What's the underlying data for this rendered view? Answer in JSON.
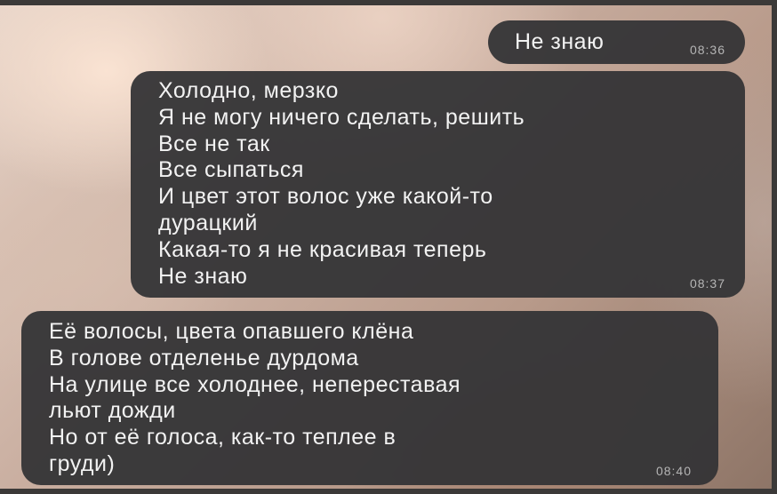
{
  "messages": [
    {
      "direction": "outgoing",
      "text": "Не знаю",
      "time": "08:36"
    },
    {
      "direction": "outgoing",
      "text": "Холодно, мерзко\nЯ не могу ничего сделать, решить\nВсе не так\nВсе сыпаться\nИ цвет этот волос уже какой-то\nдурацкий\nКакая-то я не красивая теперь\nНе знаю",
      "time": "08:37"
    },
    {
      "direction": "incoming",
      "text": "Её волосы, цвета опавшего клёна\nВ голове отделенье дурдома\nНа улице все холоднее, непереставая\nльют дожди\nНо от её голоса, как-то теплее в\nгруди)",
      "time": "08:40"
    }
  ],
  "colors": {
    "bubble": "#343436",
    "text": "#f2f2f2",
    "time": "#b5b5b5"
  }
}
